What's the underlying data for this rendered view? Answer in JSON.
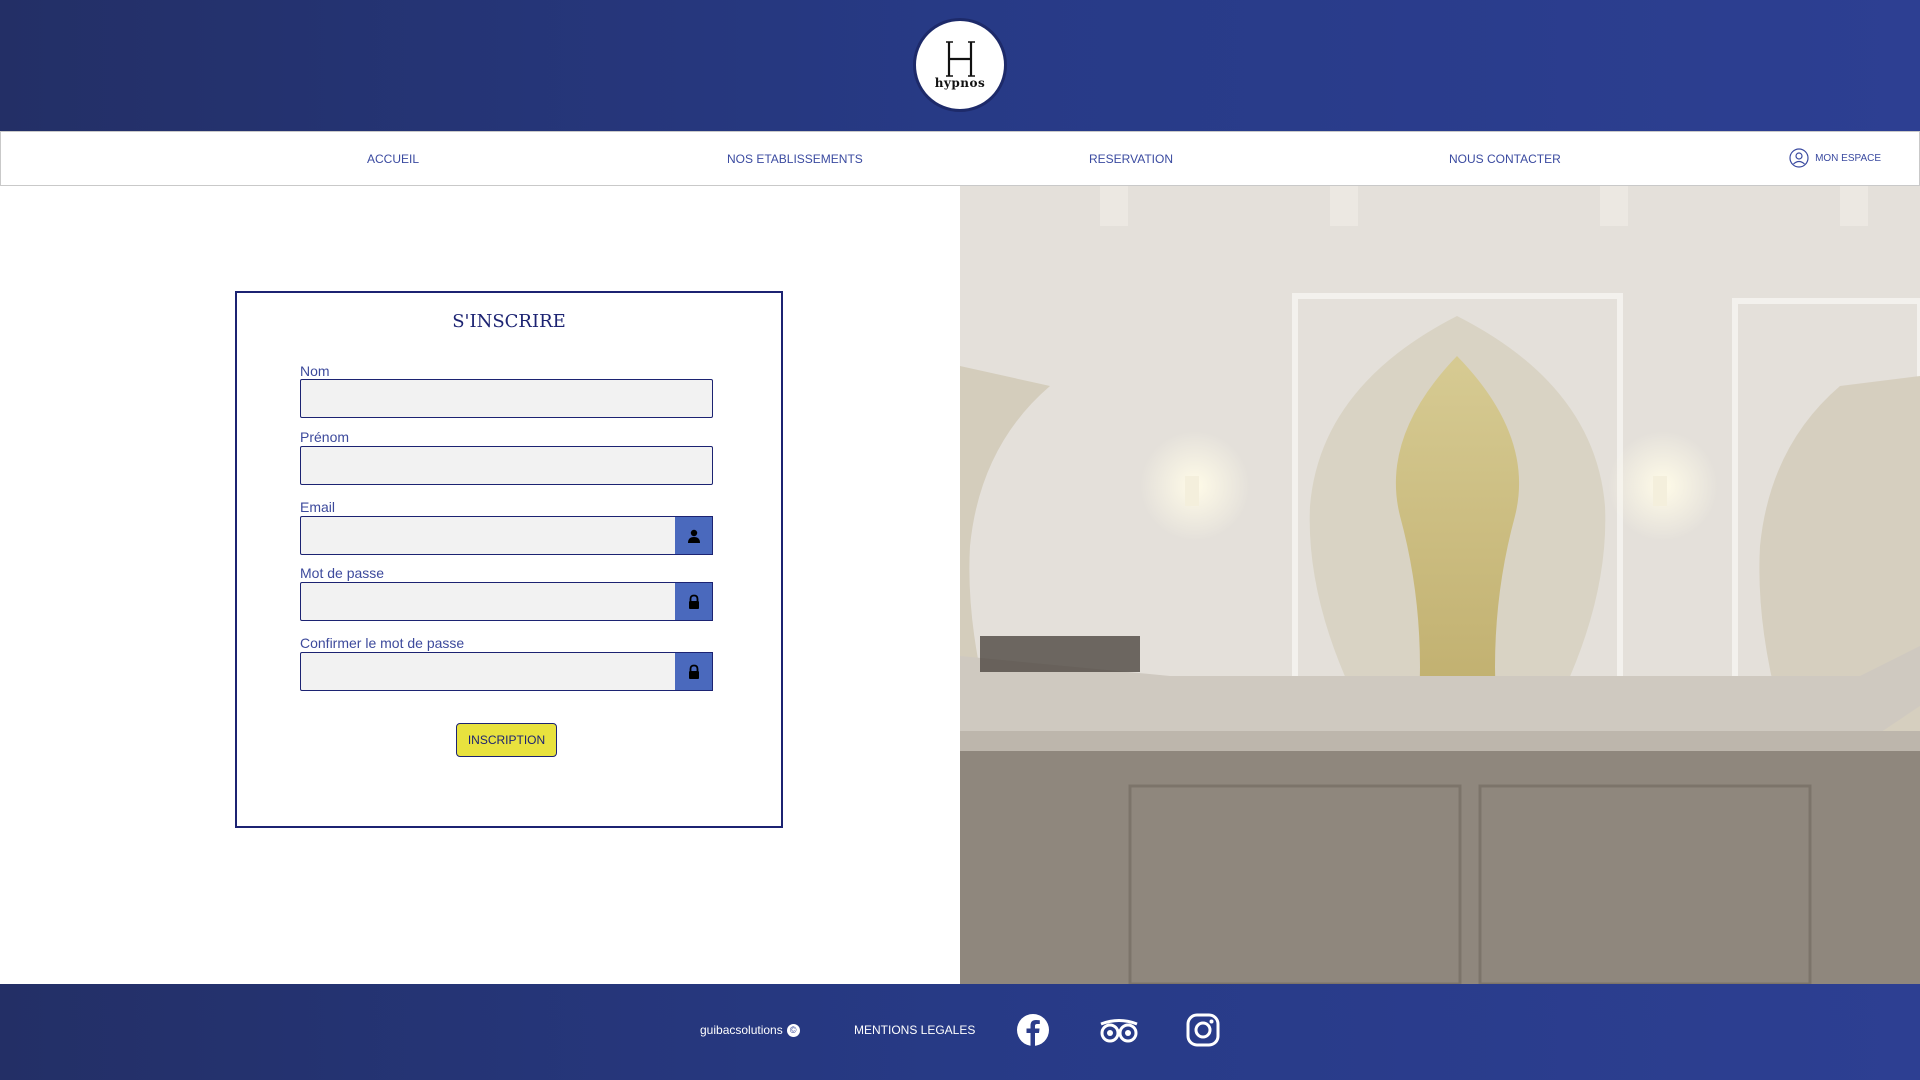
{
  "brand": {
    "logo_text": "hypnos"
  },
  "nav": {
    "items": [
      "ACCUEIL",
      "NOS ETABLISSEMENTS",
      "RESERVATION",
      "NOUS CONTACTER"
    ],
    "account_label": "MON ESPACE"
  },
  "signup": {
    "title": "S'INSCRIRE",
    "fields": [
      {
        "label": "Nom",
        "value": ""
      },
      {
        "label": "Prénom",
        "value": ""
      },
      {
        "label": "Email",
        "value": "",
        "icon": "user-icon"
      },
      {
        "label": "Mot de passe",
        "value": "",
        "icon": "lock-icon"
      },
      {
        "label": "Confirmer le mot de passe",
        "value": "",
        "icon": "lock-icon"
      }
    ],
    "submit_label": "INSCRIPTION"
  },
  "footer": {
    "brand": "guibacsolutions",
    "legal": "MENTIONS LEGALES",
    "social": [
      "facebook-icon",
      "tripadvisor-icon",
      "instagram-icon"
    ]
  },
  "colors": {
    "navy": "#1c2372",
    "header_blue": "#273a86",
    "nav_text": "#3a4aa0",
    "button_yellow": "#e8e23e",
    "addon_blue": "#4a69bd",
    "input_bg": "#f2f2f2"
  }
}
